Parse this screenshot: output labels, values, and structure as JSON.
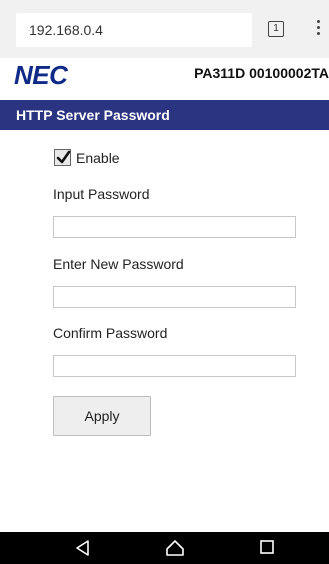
{
  "browser": {
    "url": "192.168.0.4",
    "tab_count": "1"
  },
  "header": {
    "logo": "NEC",
    "model_id": "PA311D 00100002TA"
  },
  "section": {
    "title": "HTTP Server Password"
  },
  "form": {
    "enable_label": "Enable",
    "enable_checked": true,
    "input_password_label": "Input Password",
    "input_password_value": "",
    "new_password_label": "Enter New Password",
    "new_password_value": "",
    "confirm_password_label": "Confirm Password",
    "confirm_password_value": "",
    "apply_label": "Apply"
  },
  "nav": {
    "back_icon": "back-triangle-icon",
    "home_icon": "home-icon",
    "recents_icon": "recents-square-icon"
  },
  "colors": {
    "section_bar": "#2b3480",
    "logo": "#102a88"
  }
}
